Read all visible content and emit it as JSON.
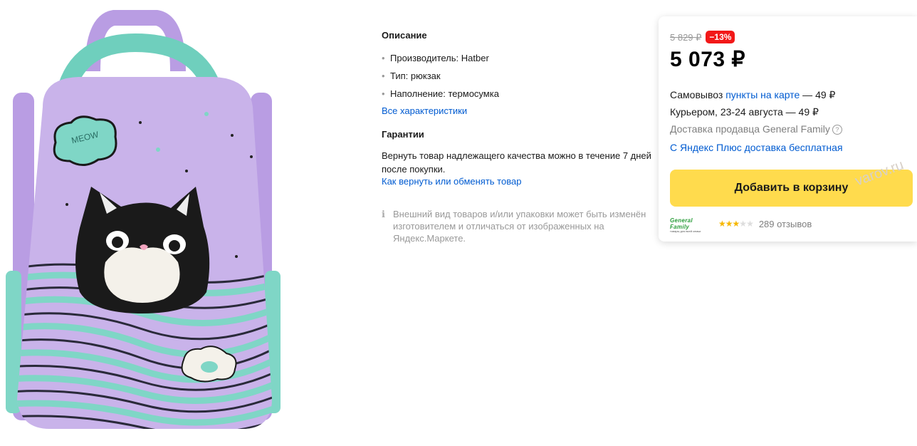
{
  "product_image": {
    "alt": "Рюкзак Hatber с котом",
    "embroidered_text": "MEOW"
  },
  "description": {
    "title": "Описание",
    "specs": [
      "Производитель: Hatber",
      "Тип: рюкзак",
      "Наполнение: термосумка"
    ],
    "all_specs_link": "Все характеристики"
  },
  "warranty": {
    "title": "Гарантии",
    "text": "Вернуть товар надлежащего качества можно в течение 7 дней после покупки.",
    "link": "Как вернуть или обменять товар"
  },
  "notice": {
    "icon": "info-icon",
    "text": "Внешний вид товаров и/или упаковки может быть изменён изготовителем и отличаться от изображенных на Яндекс.Маркете."
  },
  "buy_box": {
    "old_price": "5 829 ₽",
    "discount": "−13%",
    "price": "5 073 ₽",
    "pickup_prefix": "Самовывоз ",
    "pickup_link": "пункты на карте",
    "pickup_suffix": " — 49 ₽",
    "courier": "Курьером, 23-24 августа — 49 ₽",
    "seller_delivery": "Доставка продавца General Family",
    "plus_delivery": "С Яндекс Плюс доставка бесплатная",
    "cart_button": "Добавить в корзину",
    "watermark": "varov.ru",
    "seller_logo_title": "General Family",
    "seller_logo_sub": "товары для всей семьи",
    "rating": 3,
    "rating_max": 5,
    "reviews": "289 отзывов"
  },
  "colors": {
    "accent_yellow": "#ffdb4d",
    "discount_red": "#f21818",
    "link_blue": "#005bd1",
    "backpack_lavender": "#c9b3ea",
    "backpack_mint": "#7fd6c6"
  }
}
